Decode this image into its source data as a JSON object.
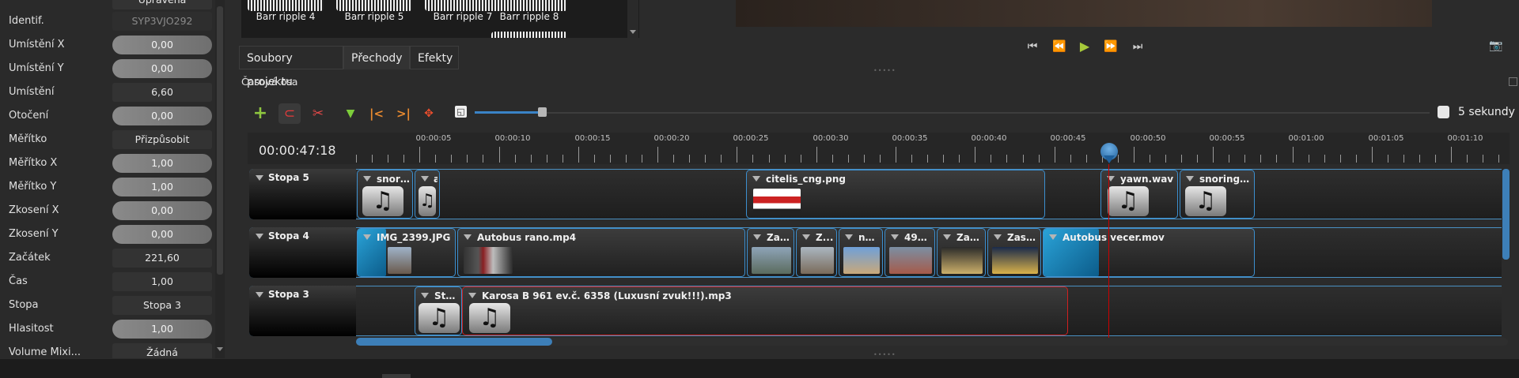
{
  "properties": {
    "header_partial": "Upravená",
    "rows": [
      {
        "label": "Identif.",
        "value": "SYP3VJO292"
      },
      {
        "label": "Umístění X",
        "value": "0,00"
      },
      {
        "label": "Umístění Y",
        "value": "0,00"
      },
      {
        "label": "Umístění",
        "value": "6,60"
      },
      {
        "label": "Otočení",
        "value": "0,00"
      },
      {
        "label": "Měřítko",
        "value": "Přizpůsobit"
      },
      {
        "label": "Měřítko X",
        "value": "1,00"
      },
      {
        "label": "Měřítko Y",
        "value": "1,00"
      },
      {
        "label": "Zkosení X",
        "value": "0,00"
      },
      {
        "label": "Zkosení Y",
        "value": "0,00"
      },
      {
        "label": "Začátek",
        "value": "221,60"
      },
      {
        "label": "Čas",
        "value": "1,00"
      },
      {
        "label": "Stopa",
        "value": "Stopa 3"
      },
      {
        "label": "Hlasitost",
        "value": "1,00"
      },
      {
        "label": "Volume Mixi...",
        "value": "Žádná"
      }
    ]
  },
  "transitions": [
    "Barr ripple 4",
    "Barr ripple 5",
    "Barr ripple 7",
    "Barr ripple 8"
  ],
  "tabs": [
    "Soubory projektu",
    "Přechody",
    "Efekty"
  ],
  "timeline": {
    "title": "Časová osa",
    "timecode": "00:00:47:18",
    "zoom_label": "5 sekundy",
    "ticks": [
      "00:00:05",
      "00:00:10",
      "00:00:15",
      "00:00:20",
      "00:00:25",
      "00:00:30",
      "00:00:35",
      "00:00:40",
      "00:00:45",
      "00:00:50",
      "00:00:55",
      "00:01:00",
      "00:01:05",
      "00:01:10"
    ],
    "tracks": [
      {
        "name": "Stopa 5",
        "clips": [
          "snori...",
          "a",
          "citelis_cng.png",
          "yawn.wav",
          "snoring...."
        ]
      },
      {
        "name": "Stopa 4",
        "clips": [
          "IMG_2399.JPG",
          "Autobus rano.mp4",
          "Zas...",
          "Z...",
          "no...",
          "492...",
          "Zas...",
          "Zast...",
          "Autobus vecer.mov"
        ]
      },
      {
        "name": "Stopa 3",
        "clips": [
          "Star...",
          "Karosa B 961 ev.č. 6358 (Luxusní zvuk!!!).mp3"
        ]
      }
    ]
  },
  "colors": {
    "accent": "#3a83c6",
    "selected_clip": "#d02020",
    "clip_border": "#3c8fcf",
    "playhead": "#cc0000"
  }
}
